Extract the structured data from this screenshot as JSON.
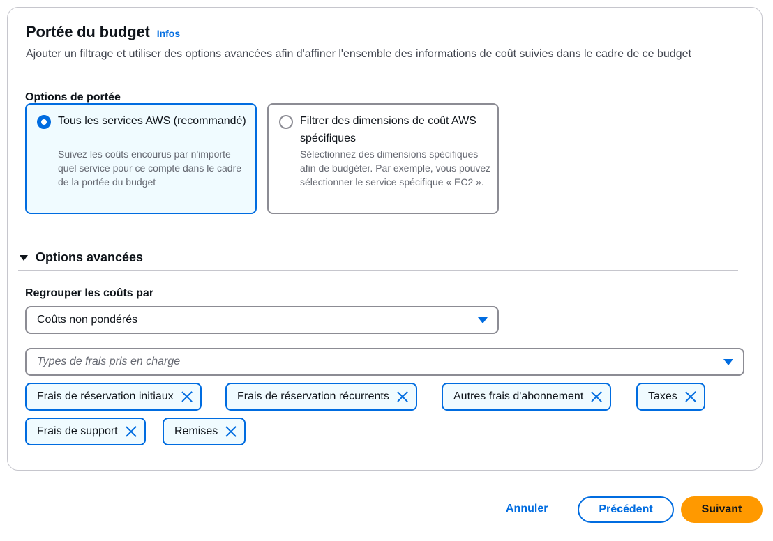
{
  "header": {
    "title": "Portée du budget",
    "info_link": "Infos",
    "description": "Ajouter un filtrage et utiliser des options avancées afin d'affiner l'ensemble des informations de coût suivies dans le cadre de ce budget"
  },
  "scope_options": {
    "label": "Options de portée",
    "tiles": [
      {
        "title": "Tous les services AWS (recommandé)",
        "description": "Suivez les coûts encourus par n'importe quel service pour ce compte dans le cadre de la portée du budget",
        "selected": true
      },
      {
        "title": "Filtrer des dimensions de coût AWS spécifiques",
        "description": "Sélectionnez des dimensions spécifiques afin de budgéter. Par exemple, vous pouvez sélectionner le service spécifique « EC2 ».",
        "selected": false
      }
    ]
  },
  "advanced": {
    "label": "Options avancées",
    "expanded": true,
    "group_by_label": "Regrouper les coûts par",
    "group_by_value": "Coûts non pondérés",
    "charge_types_placeholder": "Types de frais pris en charge",
    "tokens": [
      "Frais de réservation initiaux",
      "Frais de réservation récurrents",
      "Autres frais d'abonnement",
      "Taxes",
      "Frais de support",
      "Remises"
    ]
  },
  "footer": {
    "cancel": "Annuler",
    "previous": "Précédent",
    "next": "Suivant"
  },
  "colors": {
    "accent": "#006ce0",
    "primary_button": "#ff9900",
    "selected_tile_bg": "#f0fbff"
  }
}
